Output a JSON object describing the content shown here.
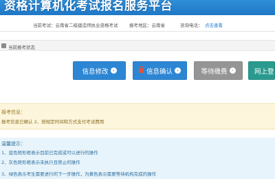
{
  "header": {
    "title": "资格计算机化考试报名服务平台"
  },
  "info_bar": {
    "exam_label": "当前考试：云南省二级建造师执业资格考试",
    "region_label": "报考地区：云南省",
    "phone_label": "咨询电话：",
    "phone_link": "点击查看"
  },
  "status_bar": {
    "text": "当前报考状态"
  },
  "actions": [
    {
      "label": "信息修改",
      "icon": "chevron-right-circle-icon",
      "color": "#2d86d4"
    },
    {
      "label": "信息确认",
      "icon": "lock-icon",
      "color": "#2d86d4"
    },
    {
      "label": "等待缴费",
      "icon": "chevron-right-circle-icon",
      "color": "#959595"
    },
    {
      "label": "网上登",
      "icon": "",
      "color": "#2a9a8e"
    }
  ],
  "notice": {
    "title": "报考信息：",
    "text": "报考信息已确认 2、按规定时间和方式支付考试费用"
  },
  "tips": {
    "title": "温馨提示：",
    "items": [
      "1、蓝色矩形框表示目前已完成或可以进行的操作",
      "2、灰色矩形框表示未执行且禁止的操作",
      "3、绿色表示考生需要进行的下一步操作，为黄色表示需要等待机构完成的操作"
    ]
  }
}
